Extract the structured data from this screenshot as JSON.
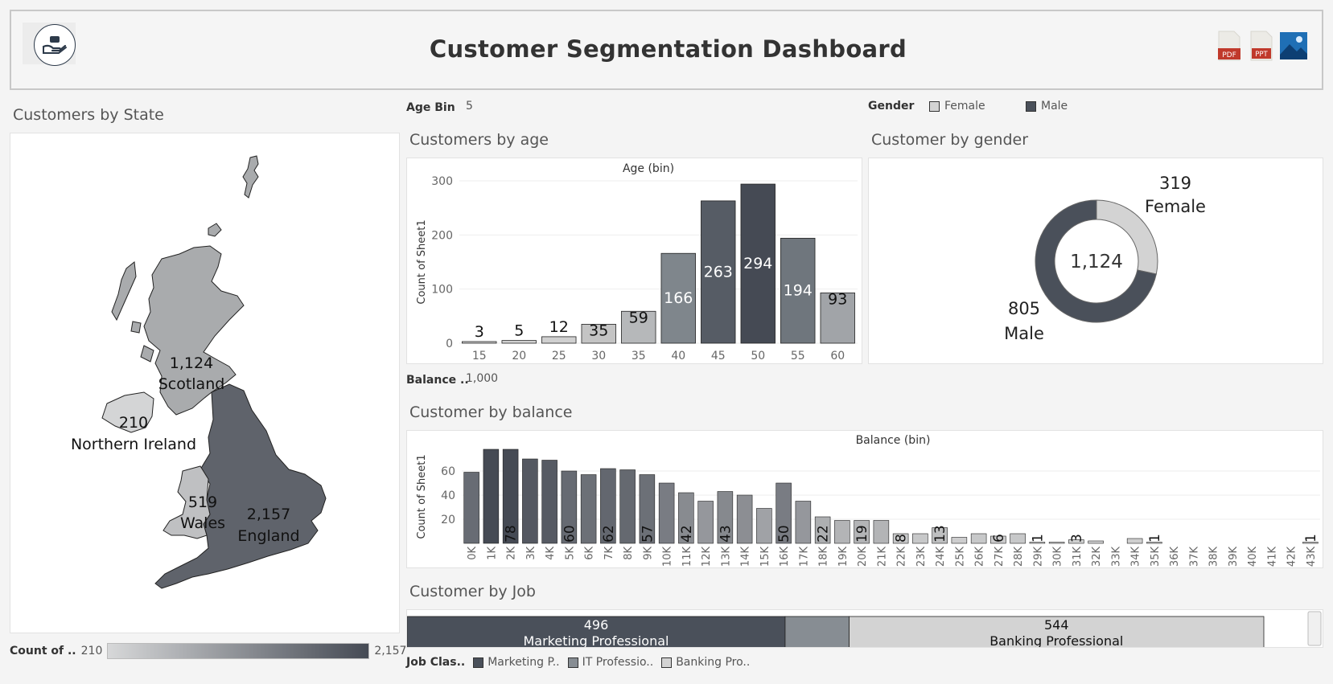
{
  "header": {
    "title": "Customer Segmentation Dashboard",
    "export_icons": [
      "pdf-icon",
      "ppt-icon",
      "image-icon"
    ],
    "export_labels": [
      "PDF",
      "PPT"
    ]
  },
  "state_panel": {
    "title": "Customers by State",
    "regions": [
      {
        "name": "Scotland",
        "value": "1,124",
        "color": "#a9abad"
      },
      {
        "name": "Northern Ireland",
        "value": "210",
        "color": "#d4d5d6"
      },
      {
        "name": "Wales",
        "value": "519",
        "color": "#bfc0c2"
      },
      {
        "name": "England",
        "value": "2,157",
        "color": "#5f636b"
      }
    ],
    "legend": {
      "label": "Count of ..",
      "min": "210",
      "max": "2,157"
    }
  },
  "filters": {
    "age_bin_label": "Age Bin",
    "age_bin_value": "5",
    "gender_label": "Gender",
    "gender_options": [
      {
        "label": "Female",
        "color": "#d3d3d3"
      },
      {
        "label": "Male",
        "color": "#4a505a"
      }
    ],
    "balance_label": "Balance ..",
    "balance_value": "1,000"
  },
  "age_chart": {
    "section_title": "Customers by age",
    "chart_data": {
      "type": "bar",
      "title": "Age (bin)",
      "ylabel": "Count of Sheet1",
      "categories": [
        "15",
        "20",
        "25",
        "30",
        "35",
        "40",
        "45",
        "50",
        "55",
        "60"
      ],
      "values": [
        3,
        5,
        12,
        35,
        59,
        166,
        263,
        294,
        194,
        93
      ],
      "ylim": [
        0,
        300
      ],
      "yticks": [
        0,
        100,
        200,
        300
      ],
      "colors": [
        "#d4d4d4",
        "#d4d4d4",
        "#d0d0d0",
        "#c4c4c4",
        "#b6b8ba",
        "#7f868c",
        "#565c65",
        "#454a54",
        "#6f767d",
        "#a1a4a8"
      ]
    }
  },
  "gender_chart": {
    "section_title": "Customer by gender",
    "chart_data": {
      "type": "pie",
      "total": "1,124",
      "slices": [
        {
          "label": "Female",
          "value": 319,
          "color": "#d3d3d3"
        },
        {
          "label": "Male",
          "value": 805,
          "color": "#4a505a"
        }
      ]
    }
  },
  "balance_chart": {
    "section_title": "Customer by balance",
    "chart_data": {
      "type": "bar",
      "title": "Balance (bin)",
      "ylabel": "Count of Sheet1",
      "categories": [
        "0K",
        "1K",
        "2K",
        "3K",
        "4K",
        "5K",
        "6K",
        "7K",
        "8K",
        "9K",
        "10K",
        "11K",
        "12K",
        "13K",
        "14K",
        "15K",
        "16K",
        "17K",
        "18K",
        "19K",
        "20K",
        "21K",
        "22K",
        "23K",
        "24K",
        "25K",
        "26K",
        "27K",
        "28K",
        "29K",
        "30K",
        "31K",
        "32K",
        "33K",
        "34K",
        "35K",
        "36K",
        "37K",
        "38K",
        "39K",
        "40K",
        "41K",
        "42K",
        "43K"
      ],
      "values": [
        59,
        78,
        78,
        70,
        69,
        60,
        57,
        62,
        61,
        57,
        50,
        42,
        35,
        43,
        40,
        29,
        50,
        35,
        22,
        19,
        19,
        19,
        8,
        8,
        13,
        5,
        8,
        6,
        8,
        1,
        1,
        3,
        2,
        0,
        4,
        1,
        0,
        0,
        0,
        0,
        0,
        0,
        0,
        1
      ],
      "labels": {
        "2": "78",
        "5": "60",
        "7": "62",
        "9": "57",
        "11": "42",
        "13": "43",
        "16": "50",
        "18": "22",
        "20": "19",
        "22": "8",
        "24": "13",
        "27": "6",
        "29": "1",
        "31": "3",
        "35": "1",
        "43": "1"
      },
      "ylim": [
        0,
        80
      ],
      "yticks": [
        20,
        40,
        60
      ]
    }
  },
  "job_chart": {
    "section_title": "Customer by Job",
    "chart_data": {
      "type": "bar",
      "segments": [
        {
          "label": "Marketing Professional",
          "value": 496,
          "color": "#4a505a"
        },
        {
          "label": "IT Professional",
          "value": 84,
          "color": "#878d93"
        },
        {
          "label": "Banking Professional",
          "value": 544,
          "color": "#d3d3d3"
        }
      ]
    },
    "value_labels": [
      "496",
      "544"
    ],
    "legend_label": "Job Clas..",
    "legend_items": [
      {
        "label": "Marketing P..",
        "color": "#4a505a"
      },
      {
        "label": "IT Professio..",
        "color": "#878d93"
      },
      {
        "label": "Banking Pro..",
        "color": "#d3d3d3"
      }
    ]
  }
}
